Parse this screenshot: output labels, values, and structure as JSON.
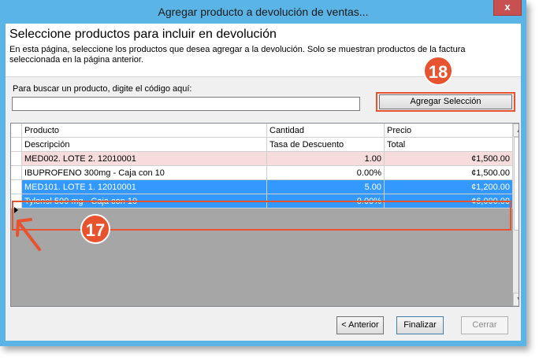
{
  "window": {
    "title": "Agregar producto a devolución de ventas...",
    "close_glyph": "x"
  },
  "header": {
    "title": "Seleccione productos para incluir en devolución",
    "description": "En esta página, seleccione los productos que desea agregar a la devolución.  Solo se muestran productos de la factura seleccionada en la página anterior."
  },
  "search": {
    "label": "Para buscar un producto, digite el código aquí:",
    "value": "",
    "placeholder": ""
  },
  "add_selection_label": "Agregar Selección",
  "annotations": {
    "badge_18": "18",
    "badge_17": "17",
    "accent_color": "#e8532f"
  },
  "grid": {
    "header_row1": [
      "Producto",
      "Cantidad",
      "Precio"
    ],
    "header_row2": [
      "Descripción",
      "Tasa de Descuento",
      "Total"
    ],
    "rows": [
      {
        "c1": "MED002. LOTE 2. 12010001",
        "c2": "1.00",
        "c3": "¢1,500.00",
        "style": "pink"
      },
      {
        "c1": "IBUPROFENO 300mg - Caja con 10",
        "c2": "0.00%",
        "c3": "¢1,500.00",
        "style": "white"
      },
      {
        "c1": "MED101. LOTE 1. 12010001",
        "c2": "5.00",
        "c3": "¢1,200.00",
        "style": "selected"
      },
      {
        "c1": "Tylenol 500 mg - Caja con 10",
        "c2": "0.00%",
        "c3": "¢6,000.00",
        "style": "selected"
      }
    ],
    "selected_color": "#3399ff",
    "pink_color": "#f6dcdc"
  },
  "scrollbar": {
    "up_icon": "chevron-up-icon",
    "down_icon": "chevron-down-icon"
  },
  "buttons": {
    "back": "< Anterior",
    "finish": "Finalizar",
    "close": "Cerrar"
  }
}
